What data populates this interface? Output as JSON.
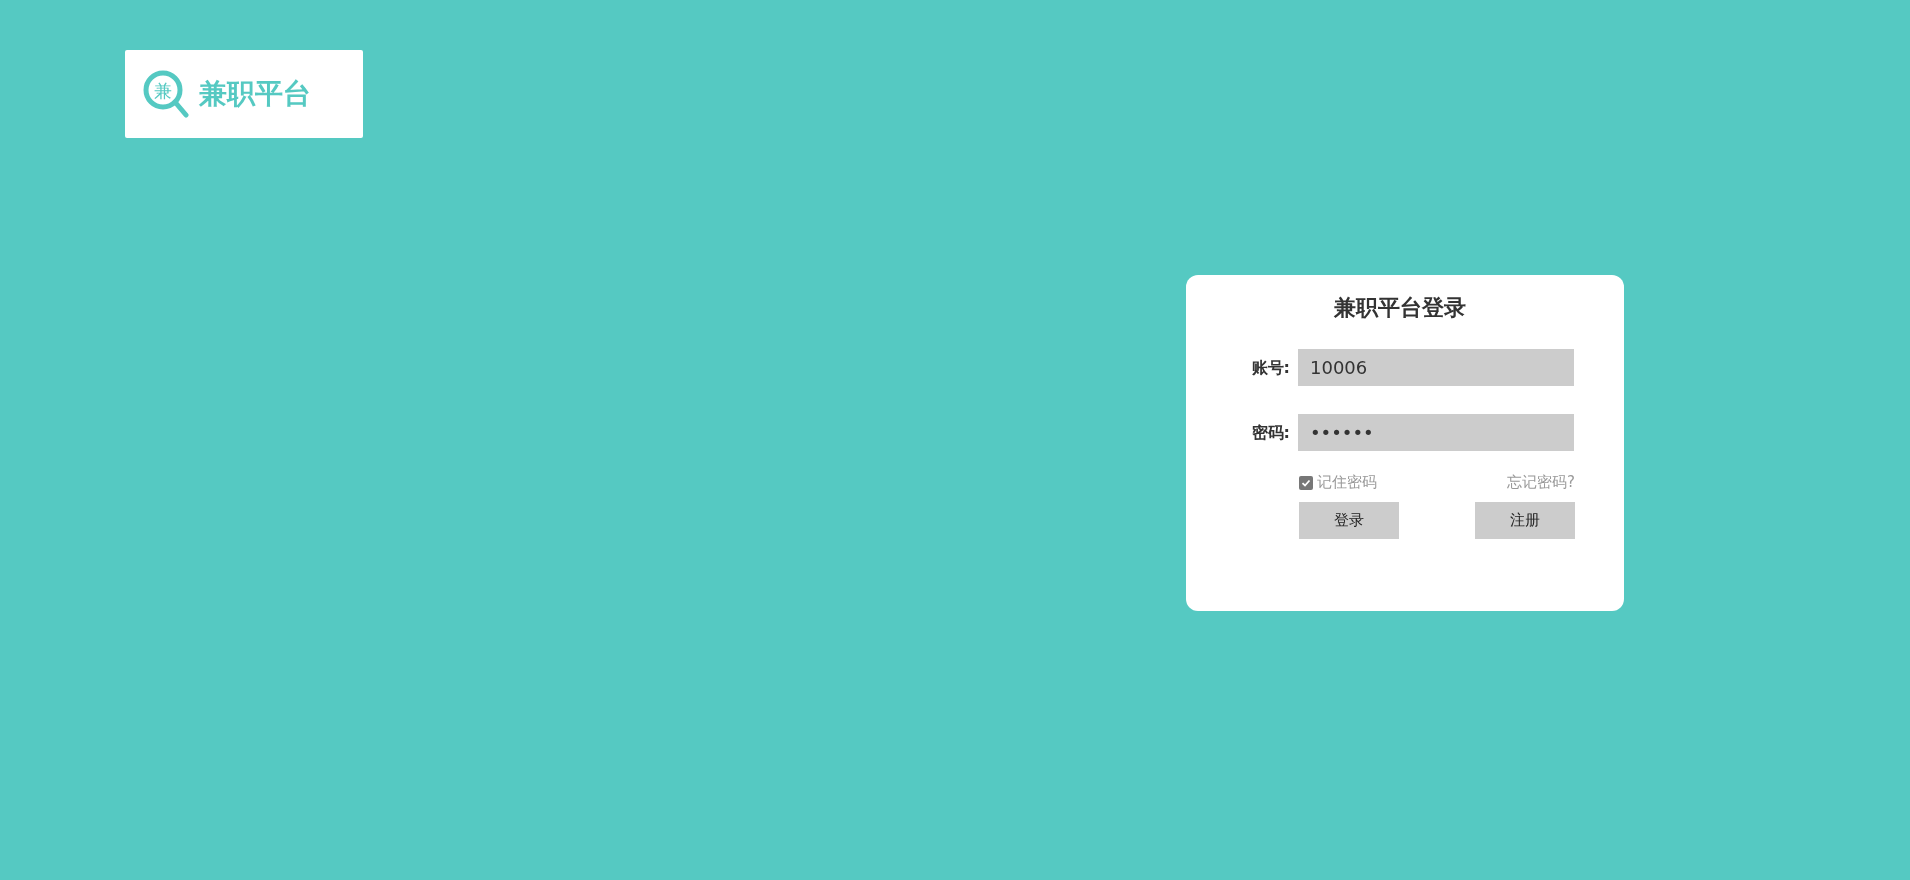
{
  "logo": {
    "icon_text": "兼",
    "title": "兼职平台"
  },
  "login": {
    "title": "兼职平台登录",
    "fields": [
      {
        "label": "账号:",
        "value": "10006"
      },
      {
        "label": "密码:",
        "value": "••••••"
      }
    ],
    "remember": {
      "label": "记住密码",
      "checked": true
    },
    "forgot": "忘记密码?",
    "buttons": [
      "登录",
      "注册"
    ]
  }
}
